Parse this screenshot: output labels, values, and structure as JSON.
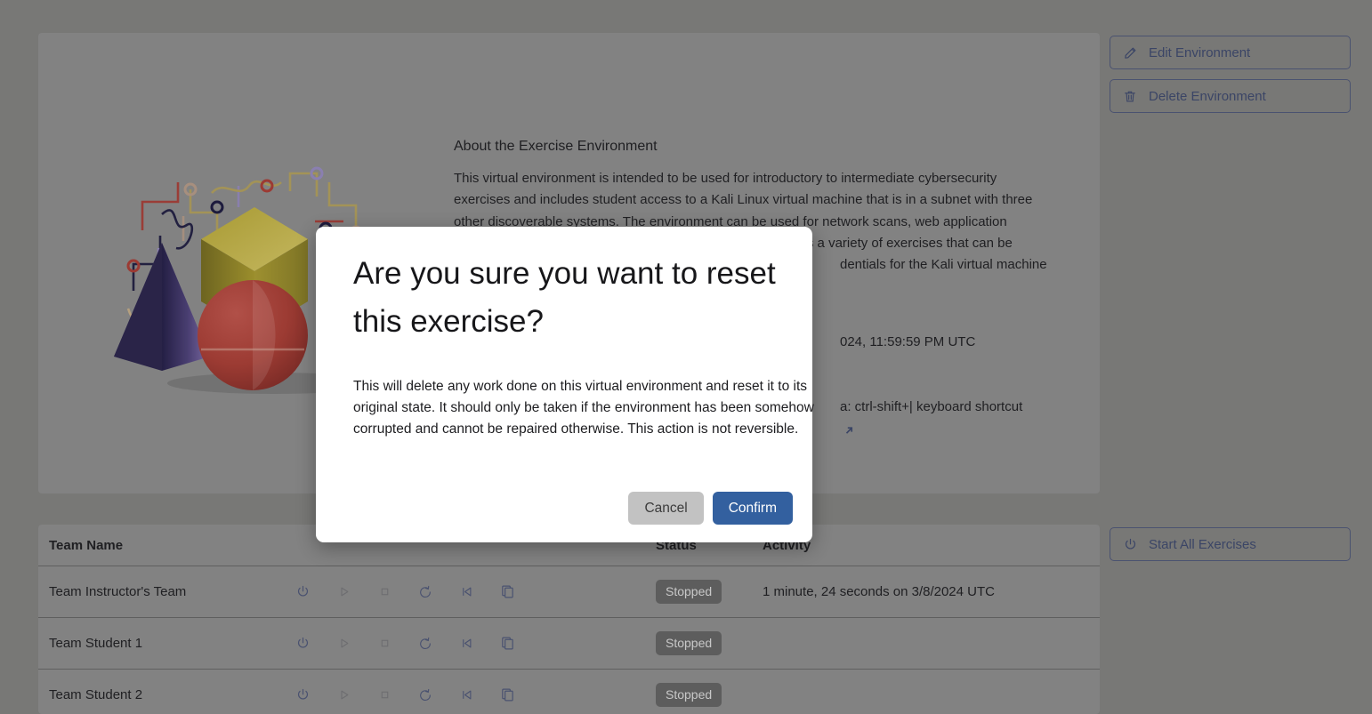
{
  "page": {
    "background_color": "#787876",
    "card_color": "#828282"
  },
  "info_card": {
    "about_title": "About the Exercise Environment",
    "about_lines": [
      "This virtual environment is intended to be used for introductory to intermediate cybersecurity",
      "exercises and includes student access to a Kali Linux virtual machine that is in a subnet with three",
      "other discoverable systems. The environment can be used for network scans, web application",
      "vulnerability exploitation, basic penetration testing, as well as a variety of exercises that can be",
      "dentials for the Kali virtual machine"
    ],
    "meta_lines": [
      "024, 11:59:59 PM UTC",
      "a: ctrl-shift+| keyboard shortcut"
    ],
    "external_link_icon": "external-link-icon"
  },
  "rail": {
    "edit_environment": {
      "label": "Edit Environment",
      "icon": "pencil-icon"
    },
    "delete_environment": {
      "label": "Delete Environment",
      "icon": "trash-icon"
    },
    "start_all_exercises": {
      "label": "Start All Exercises",
      "icon": "power-icon"
    },
    "border_color": "#4a5270",
    "text_color": "#3b4566"
  },
  "teams_table": {
    "columns": [
      "Team Name",
      "",
      "Status",
      "Activity"
    ],
    "row_actions": [
      "power-icon",
      "play-icon",
      "stop-icon",
      "reset-icon",
      "skip-back-icon",
      "copy-icon"
    ],
    "rows": [
      {
        "name": "Team Instructor's Team",
        "status": "Stopped",
        "activity": "1 minute, 24 seconds on 3/8/2024 UTC"
      },
      {
        "name": "Team Student 1",
        "status": "Stopped",
        "activity": ""
      },
      {
        "name": "Team Student 2",
        "status": "Stopped",
        "activity": ""
      }
    ],
    "badge_bg": "#5d5d5d",
    "badge_text_color": "#c8c8c8"
  },
  "modal": {
    "title": "Are you sure you want to reset this exercise?",
    "body": "This will delete any work done on this virtual environment and reset it to its original state. It should only be taken if the environment has been somehow corrupted and cannot be repaired otherwise. This action is not reversible.",
    "cancel_label": "Cancel",
    "confirm_label": "Confirm",
    "cancel_color": "#c2c2c2",
    "confirm_color": "#33609f"
  }
}
